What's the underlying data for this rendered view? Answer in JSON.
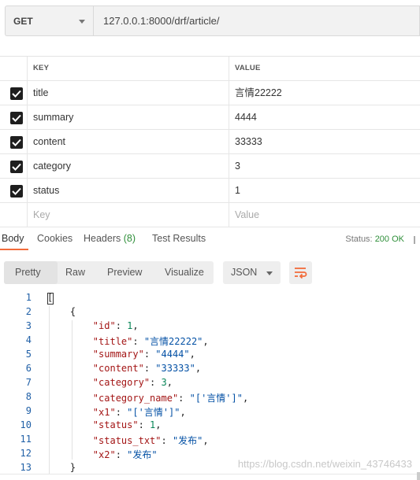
{
  "request": {
    "method": "GET",
    "url": "127.0.0.1:8000/drf/article/"
  },
  "params": {
    "key_header": "KEY",
    "value_header": "VALUE",
    "rows": [
      {
        "key": "title",
        "value": "言情22222",
        "checked": true
      },
      {
        "key": "summary",
        "value": "4444",
        "checked": true
      },
      {
        "key": "content",
        "value": "33333",
        "checked": true
      },
      {
        "key": "category",
        "value": "3",
        "checked": true
      },
      {
        "key": "status",
        "value": "1",
        "checked": true
      }
    ],
    "key_placeholder": "Key",
    "value_placeholder": "Value"
  },
  "response_tabs": {
    "body": "Body",
    "cookies": "Cookies",
    "headers": "Headers",
    "headers_count": "(8)",
    "test_results": "Test Results",
    "status_label": "Status:",
    "status_value": "200 OK"
  },
  "view": {
    "modes": [
      "Pretty",
      "Raw",
      "Preview",
      "Visualize"
    ],
    "selected": "Pretty",
    "format": "JSON",
    "icons": {
      "wrap": "wrap-lines-icon",
      "dropdown": "chevron-down-icon",
      "checkbox": "checkbox-checked-icon"
    }
  },
  "code": {
    "line_numbers": [
      "1",
      "2",
      "3",
      "4",
      "5",
      "6",
      "7",
      "8",
      "9",
      "10",
      "11",
      "12",
      "13"
    ],
    "lines": [
      {
        "t": "p",
        "text": "["
      },
      {
        "t": "p",
        "text": "    {"
      },
      {
        "t": "kv",
        "key": "\"id\"",
        "val": "1",
        "vt": "n",
        "end": ","
      },
      {
        "t": "kv",
        "key": "\"title\"",
        "val": "\"言情22222\"",
        "vt": "s",
        "end": ","
      },
      {
        "t": "kv",
        "key": "\"summary\"",
        "val": "\"4444\"",
        "vt": "s",
        "end": ","
      },
      {
        "t": "kv",
        "key": "\"content\"",
        "val": "\"33333\"",
        "vt": "s",
        "end": ","
      },
      {
        "t": "kv",
        "key": "\"category\"",
        "val": "3",
        "vt": "n",
        "end": ","
      },
      {
        "t": "kv",
        "key": "\"category_name\"",
        "val": "\"['言情']\"",
        "vt": "s",
        "end": ","
      },
      {
        "t": "kv",
        "key": "\"x1\"",
        "val": "\"['言情']\"",
        "vt": "s",
        "end": ","
      },
      {
        "t": "kv",
        "key": "\"status\"",
        "val": "1",
        "vt": "n",
        "end": ","
      },
      {
        "t": "kv",
        "key": "\"status_txt\"",
        "val": "\"发布\"",
        "vt": "s",
        "end": ","
      },
      {
        "t": "kv",
        "key": "\"x2\"",
        "val": "\"发布\"",
        "vt": "s",
        "end": ""
      },
      {
        "t": "p",
        "text": "    }"
      }
    ]
  },
  "watermark": "https://blog.csdn.net/weixin_43746433"
}
